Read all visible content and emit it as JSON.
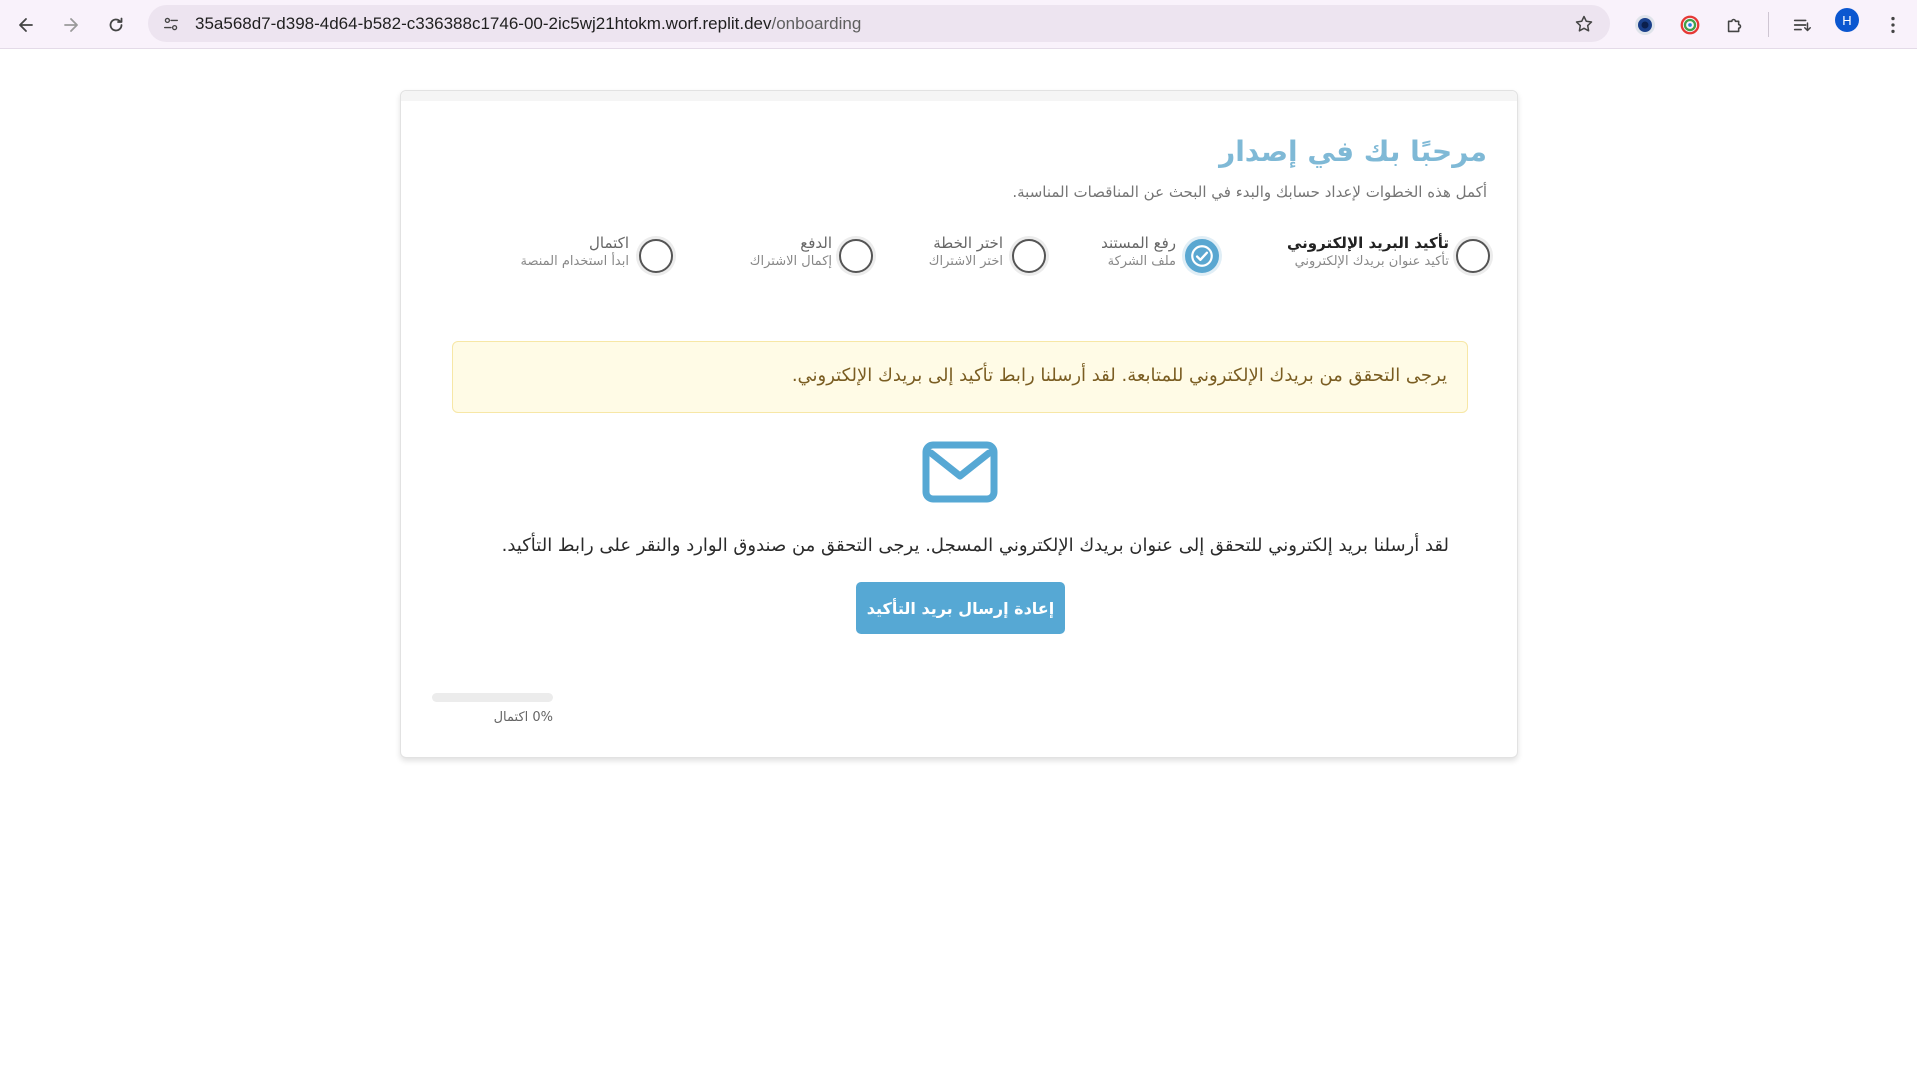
{
  "browser": {
    "url_host": "35a568d7-d398-4d64-b582-c336388c1746-00-2ic5wj21htokm.worf.replit.dev",
    "url_path": "/onboarding",
    "profile_initial": "H"
  },
  "page": {
    "title": "مرحبًا بك في إصدار",
    "subtitle": "أكمل هذه الخطوات لإعداد حسابك والبدء في البحث عن المناقصات المناسبة.",
    "steps": [
      {
        "label": "تأكيد البريد الإلكتروني",
        "desc": "تأكيد عنوان بريدك الإلكتروني",
        "state": "current"
      },
      {
        "label": "رفع المستند",
        "desc": "ملف الشركة",
        "state": "completed"
      },
      {
        "label": "اختر الخطة",
        "desc": "اختر الاشتراك",
        "state": "pending"
      },
      {
        "label": "الدفع",
        "desc": "إكمال الاشتراك",
        "state": "pending"
      },
      {
        "label": "اكتمال",
        "desc": "ابدأ استخدام المنصة",
        "state": "pending"
      }
    ],
    "alert_text": "يرجى التحقق من بريدك الإلكتروني للمتابعة. لقد أرسلنا رابط تأكيد إلى بريدك الإلكتروني.",
    "mail_icon": "envelope-icon",
    "info_text": "لقد أرسلنا بريد إلكتروني للتحقق إلى عنوان بريدك الإلكتروني المسجل. يرجى التحقق من صندوق الوارد والنقر على رابط التأكيد.",
    "resend_button": "إعادة إرسال بريد التأكيد",
    "progress_percent": 0,
    "progress_label": "0% اكتمال"
  },
  "colors": {
    "accent": "#56a8d4",
    "title": "#7fb9d6",
    "alert_bg": "#fffbe6",
    "alert_text": "#7a5d22"
  }
}
